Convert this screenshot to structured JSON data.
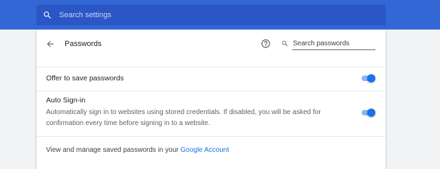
{
  "search": {
    "placeholder": "Search settings"
  },
  "header": {
    "title": "Passwords",
    "search_passwords_placeholder": "Search passwords"
  },
  "offer_to_save": {
    "label": "Offer to save passwords",
    "enabled": true
  },
  "auto_signin": {
    "label": "Auto Sign-in",
    "description": "Automatically sign in to websites using stored credentials. If disabled, you will be asked for confirmation every time before signing in to a website.",
    "enabled": true
  },
  "manage": {
    "prefix": "View and manage saved passwords in your ",
    "link_text": "Google Account"
  },
  "icons": {
    "search": "search-icon",
    "back": "arrow-back-icon",
    "help": "help-circle-icon",
    "password_search": "search-icon"
  },
  "colors": {
    "topbar": "#3367d6",
    "searchbox": "#2a56c6",
    "toggle_on": "#1a73e8",
    "link": "#1a73e8"
  }
}
